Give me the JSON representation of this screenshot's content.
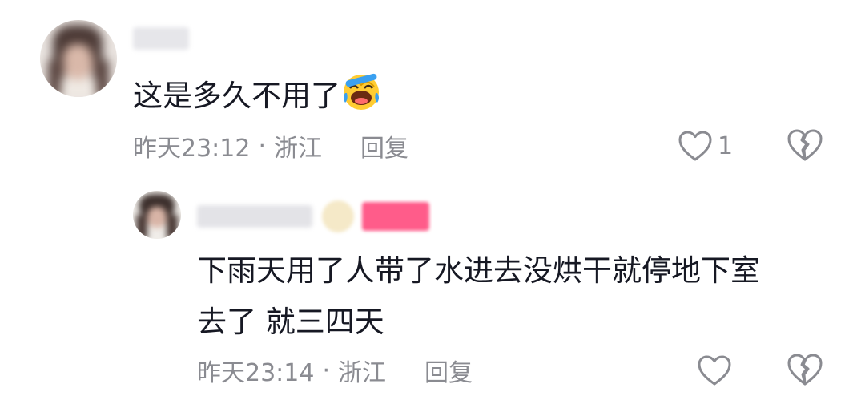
{
  "comments": [
    {
      "text": "这是多久不用了",
      "emoji": "laughing-crying-emoji",
      "time": "昨天23:12",
      "separator": "·",
      "location": "浙江",
      "reply_label": "回复",
      "like_count": "1"
    }
  ],
  "replies": [
    {
      "text_line1": "下雨天用了人带了水进去没烘干就停地下室",
      "text_line2": "去了 就三四天",
      "time": "昨天23:14",
      "separator": "·",
      "location": "浙江",
      "reply_label": "回复"
    }
  ],
  "icons": {
    "like": "heart-outline-icon",
    "dislike": "broken-heart-icon"
  },
  "colors": {
    "text": "#161823",
    "meta": "#8a8b91",
    "badge": "#ff5c8a"
  }
}
